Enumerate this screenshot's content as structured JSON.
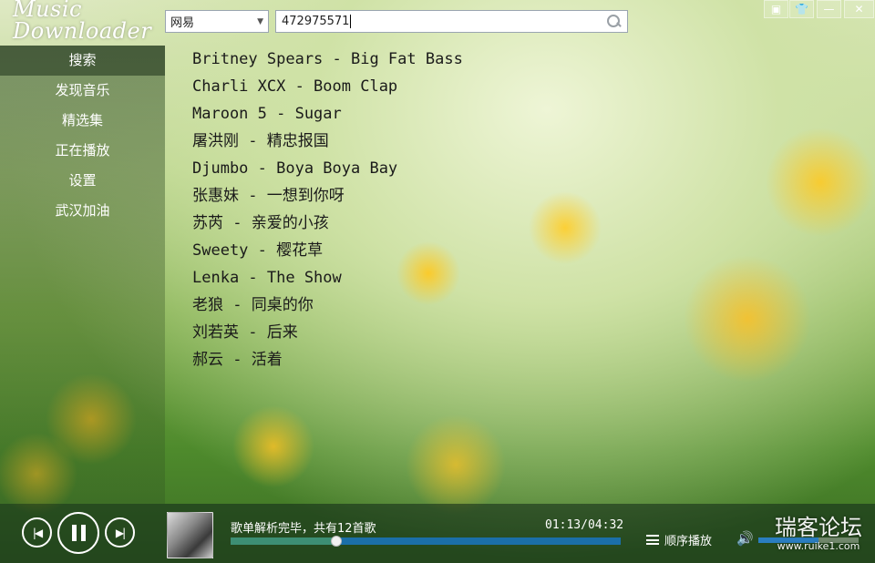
{
  "app": {
    "logo_line1": "Music",
    "logo_line2": "Downloader"
  },
  "window_controls": {
    "mini_mode_icon": "mini-mode-icon",
    "skin_icon": "shirt-icon",
    "minimize_icon": "minimize-icon",
    "close_icon": "close-icon"
  },
  "search": {
    "source_selected": "网易",
    "query_value": "472975571",
    "search_icon": "search-icon"
  },
  "sidebar": {
    "items": [
      {
        "label": "搜索",
        "active": true
      },
      {
        "label": "发现音乐"
      },
      {
        "label": "精选集"
      },
      {
        "label": "正在播放"
      },
      {
        "label": "设置"
      },
      {
        "label": "武汉加油"
      }
    ]
  },
  "songs": [
    "Britney Spears - Big Fat Bass",
    "Charli XCX - Boom Clap",
    "Maroon 5 - Sugar",
    "屠洪刚 - 精忠报国",
    "Djumbo - Boya Boya Bay",
    "张惠妹 - 一想到你呀",
    "苏芮 - 亲爱的小孩",
    "Sweety - 樱花草",
    "Lenka - The Show",
    "老狼 - 同桌的你",
    "刘若英 - 后来",
    "郝云 - 活着"
  ],
  "player": {
    "status": "歌单解析完毕，共有12首歌",
    "time": "01:13/04:32",
    "progress": 0.27,
    "play_mode": "顺序播放",
    "volume": 0.6,
    "accent_color": "#1b6fa8"
  },
  "watermark": {
    "title": "瑞客论坛",
    "url": "www.ruike1.com"
  }
}
